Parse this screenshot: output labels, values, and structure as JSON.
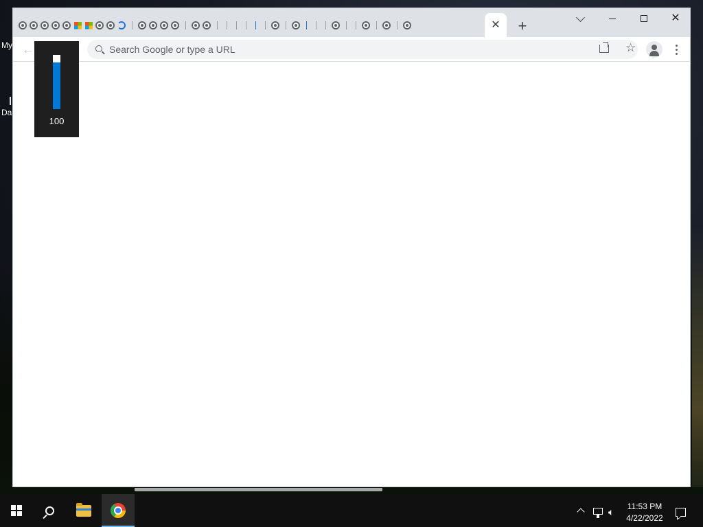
{
  "desktop": {
    "icon_labels": [
      "My",
      "Da"
    ]
  },
  "browser": {
    "tab_icons": [
      "chrome",
      "chrome",
      "chrome",
      "chrome",
      "chrome",
      "ms",
      "ms",
      "chrome",
      "chrome",
      "loading",
      "sep",
      "chrome",
      "chrome",
      "chrome",
      "chrome",
      "sep",
      "chrome",
      "chrome",
      "sep",
      "sep",
      "sep",
      "sep",
      "sepblue",
      "sep",
      "chrome",
      "sep",
      "chrome",
      "sepblue",
      "sep",
      "sep",
      "chrome",
      "sep",
      "sep",
      "chrome",
      "sep",
      "chrome",
      "sep",
      "chrome"
    ],
    "active_tab_close": "✕",
    "new_tab": "+",
    "omnibox": {
      "placeholder": "Search Google or type a URL",
      "value": ""
    }
  },
  "volume_osd": {
    "value": "100",
    "level_percent": 100,
    "fill_color": "#0078d7"
  },
  "taskbar": {
    "time": "11:53 PM",
    "date": "4/22/2022"
  },
  "icons": {
    "back": "arrow-left-icon",
    "search": "search-icon",
    "share": "share-icon",
    "bookmark": "star-icon",
    "profile": "person-icon",
    "menu": "kebab-menu-icon"
  }
}
